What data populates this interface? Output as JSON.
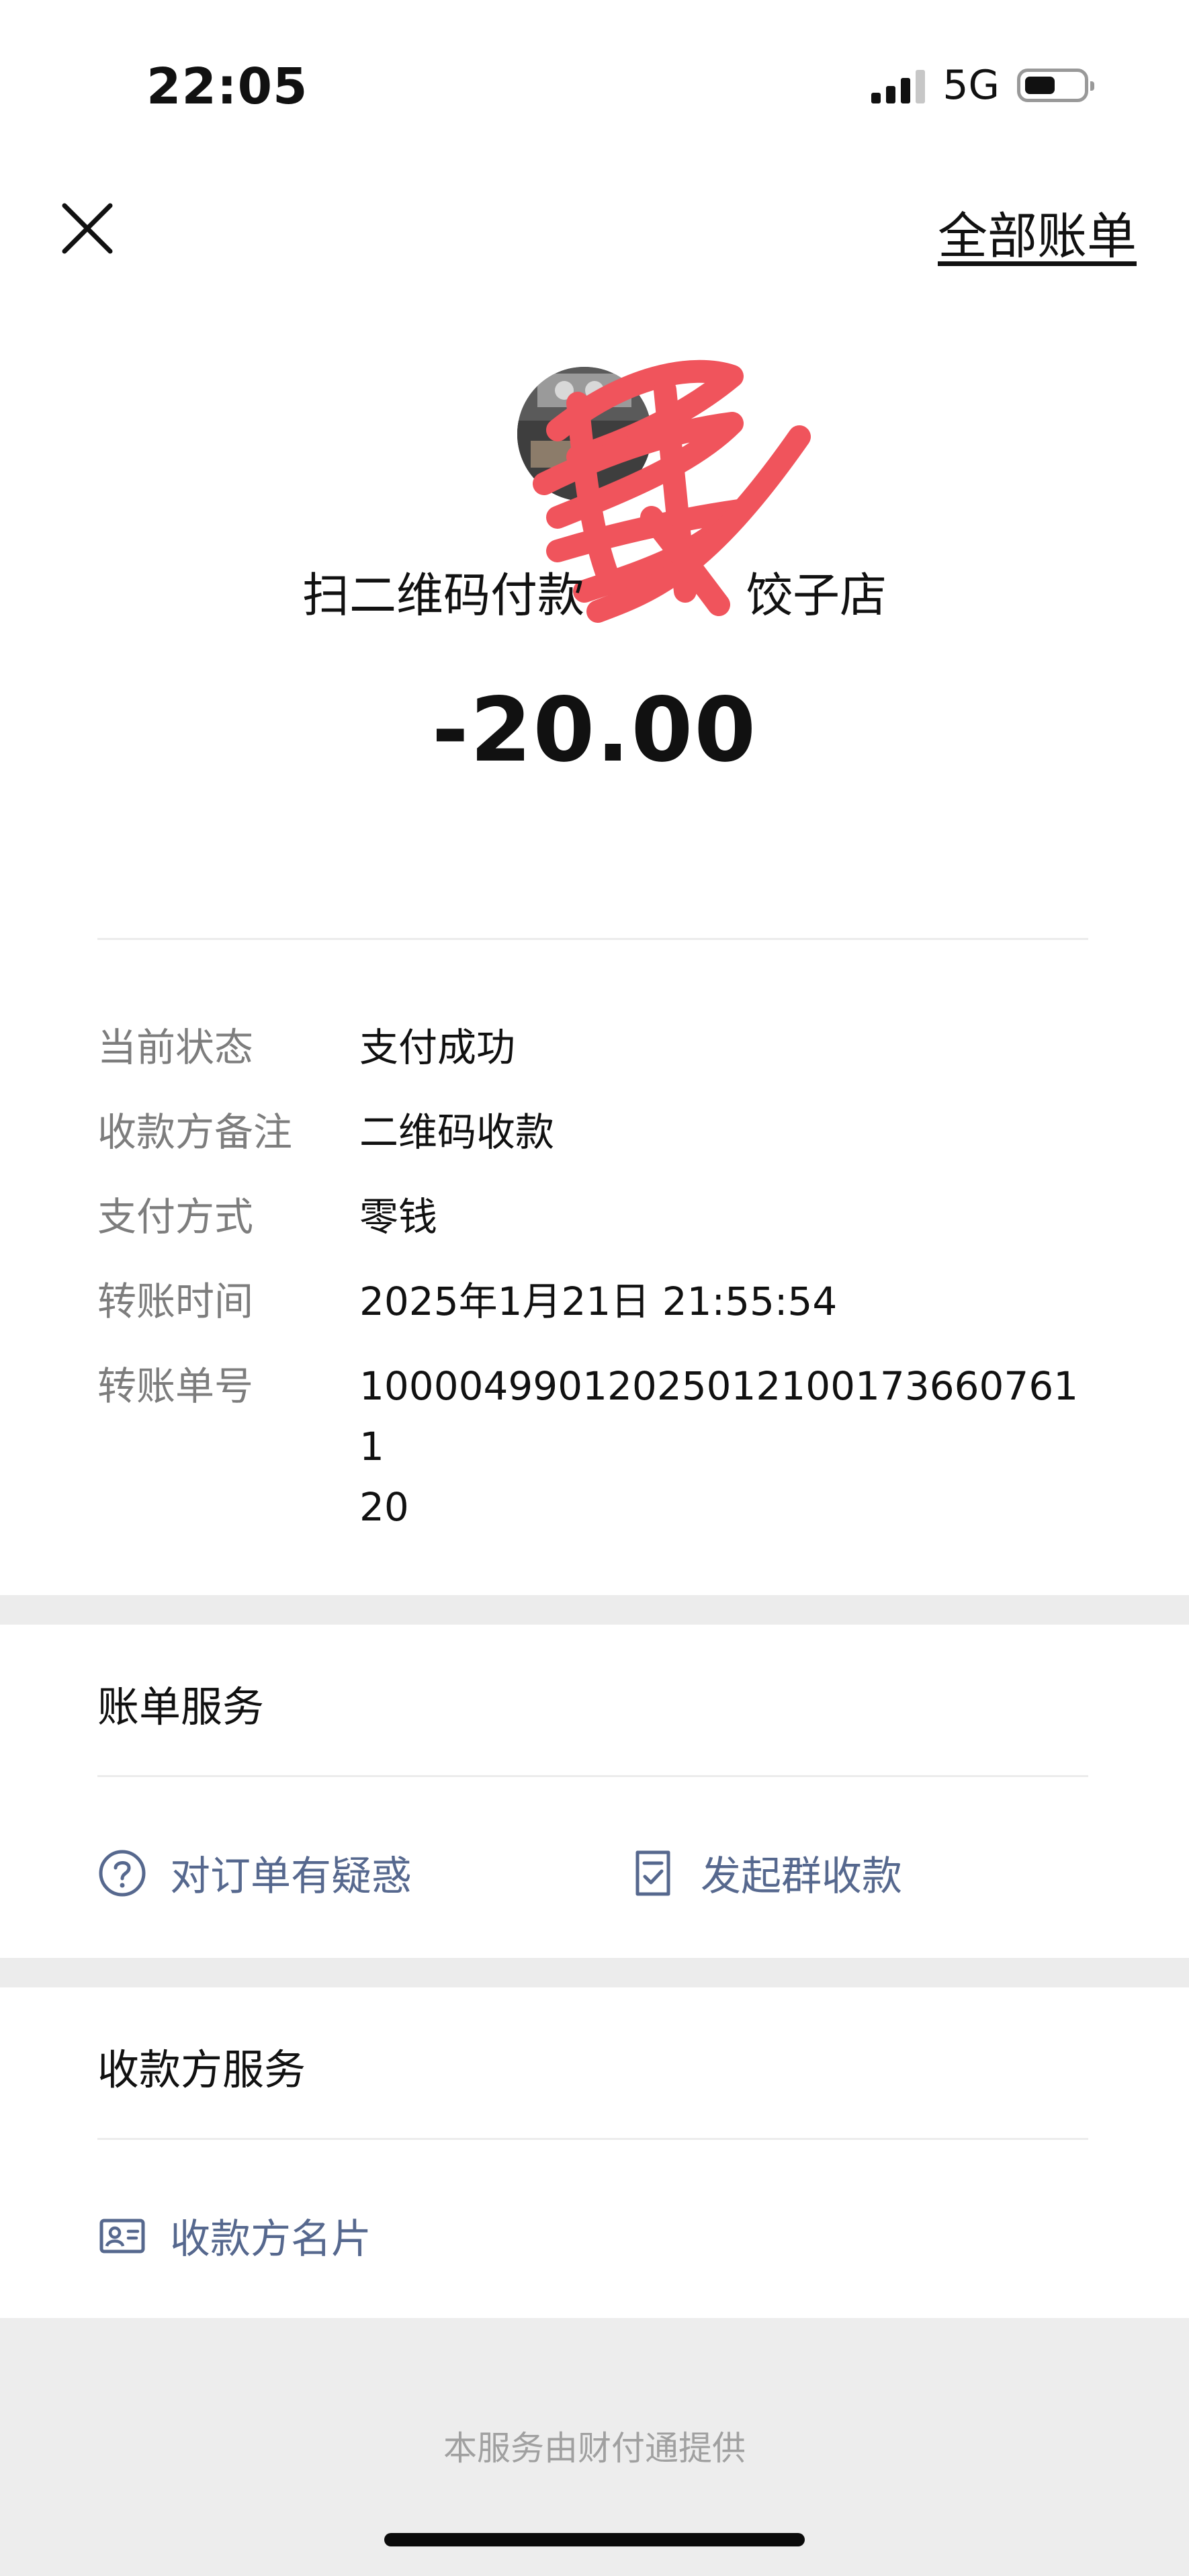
{
  "status_bar": {
    "time": "22:05",
    "network": "5G"
  },
  "header": {
    "all_bills": "全部账单"
  },
  "payment": {
    "merchant_prefix": "扫二维码付款",
    "merchant_suffix": "饺子店",
    "amount": "-20.00"
  },
  "details": [
    {
      "label": "当前状态",
      "value": "支付成功"
    },
    {
      "label": "收款方备注",
      "value": "二维码收款"
    },
    {
      "label": "支付方式",
      "value": "零钱"
    },
    {
      "label": "转账时间",
      "value": "2025年1月21日 21:55:54"
    },
    {
      "label": "转账单号",
      "value": "100004990120250121001736607611\n20"
    }
  ],
  "bill_service": {
    "title": "账单服务",
    "question_order": "对订单有疑惑",
    "group_collect": "发起群收款"
  },
  "payee_service": {
    "title": "收款方服务",
    "payee_card": "收款方名片"
  },
  "footer": {
    "provided_by": "本服务由财付通提供"
  },
  "colors": {
    "link": "#56688e",
    "scribble": "#f0545c",
    "band": "#ececec"
  }
}
